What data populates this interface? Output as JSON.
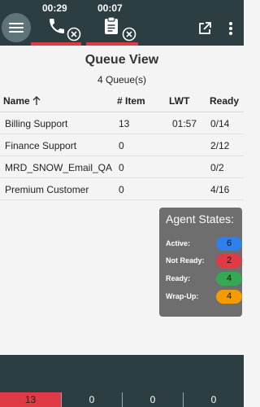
{
  "colors": {
    "topbar": "#2c3e42",
    "alert_red": "#e03a45",
    "active": "#2f80ed",
    "not_ready": "#e03a45",
    "ready": "#34a853",
    "wrap_up": "#f59b00",
    "card": "#6e6e6e"
  },
  "topbar": {
    "menu_icon": "hamburger-icon",
    "tasks": [
      {
        "timer": "00:29",
        "icon": "phone-icon"
      },
      {
        "timer": "00:07",
        "icon": "clipboard-icon"
      }
    ],
    "right_icons": [
      "open-external-icon",
      "more-vert-icon"
    ]
  },
  "header": {
    "title": "Queue View",
    "subtitle": "4 Queue(s)"
  },
  "table": {
    "columns": [
      "Name",
      "# Item",
      "LWT",
      "Ready"
    ],
    "rows": [
      {
        "name": "Billing Support",
        "items": "13",
        "lwt": "01:57",
        "ready": "0/14"
      },
      {
        "name": "Finance Support",
        "items": "0",
        "lwt": "",
        "ready": "2/12"
      },
      {
        "name": "MRD_SNOW_Email_QA",
        "items": "0",
        "lwt": "",
        "ready": "0/2"
      },
      {
        "name": "Premium Customer",
        "items": "0",
        "lwt": "",
        "ready": "4/16"
      }
    ]
  },
  "agent_states": {
    "title": "Agent States:",
    "states": [
      {
        "label": "Active:",
        "count": "6",
        "color": "#2f80ed"
      },
      {
        "label": "Not Ready:",
        "count": "2",
        "color": "#e03a45"
      },
      {
        "label": "Ready:",
        "count": "4",
        "color": "#34a853"
      },
      {
        "label": "Wrap-Up:",
        "count": "4",
        "color": "#f59b00"
      }
    ]
  },
  "bottom_bar": {
    "cells": [
      "13",
      "0",
      "0",
      "0"
    ]
  }
}
